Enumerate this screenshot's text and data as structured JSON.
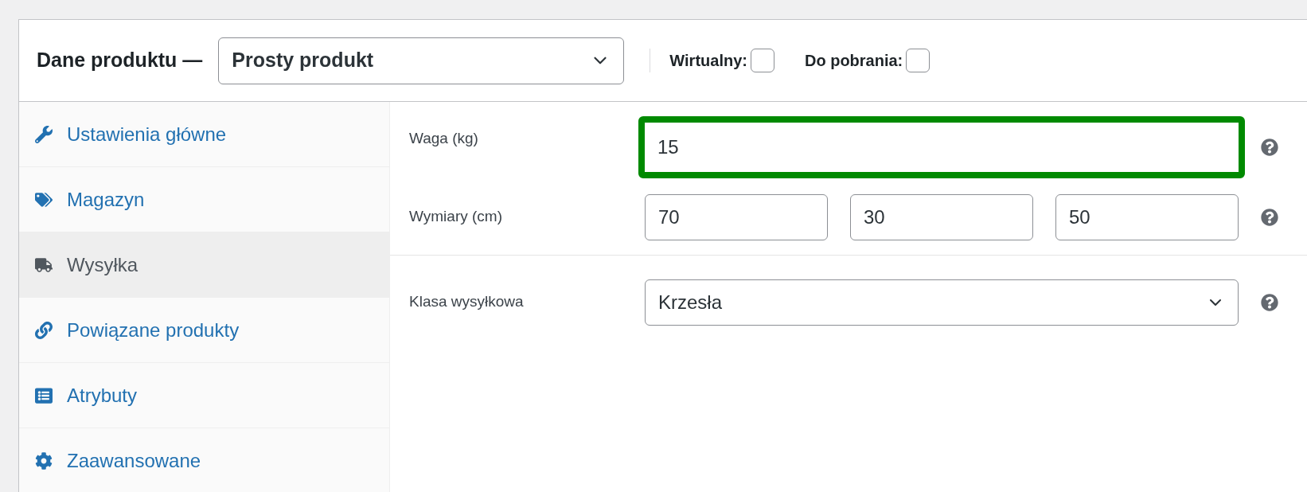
{
  "header": {
    "title": "Dane produktu —",
    "product_type": {
      "value": "Prosty produkt"
    },
    "options": [
      {
        "label": "Wirtualny:",
        "checked": false
      },
      {
        "label": "Do pobrania:",
        "checked": false
      }
    ]
  },
  "sidebar": {
    "items": [
      {
        "label": "Ustawienia główne",
        "selected": false
      },
      {
        "label": "Magazyn",
        "selected": false
      },
      {
        "label": "Wysyłka",
        "selected": true
      },
      {
        "label": "Powiązane produkty",
        "selected": false
      },
      {
        "label": "Atrybuty",
        "selected": false
      },
      {
        "label": "Zaawansowane",
        "selected": false
      }
    ]
  },
  "sections": [
    {
      "fields": [
        {
          "kind": "text",
          "label": "Waga (kg)",
          "value": "15",
          "highlighted": true
        },
        {
          "kind": "dimensions",
          "label": "Wymiary (cm)",
          "values": [
            "70",
            "30",
            "50"
          ]
        }
      ]
    },
    {
      "fields": [
        {
          "kind": "select",
          "label": "Klasa wysyłkowa",
          "value": "Krzesła"
        }
      ]
    }
  ]
}
